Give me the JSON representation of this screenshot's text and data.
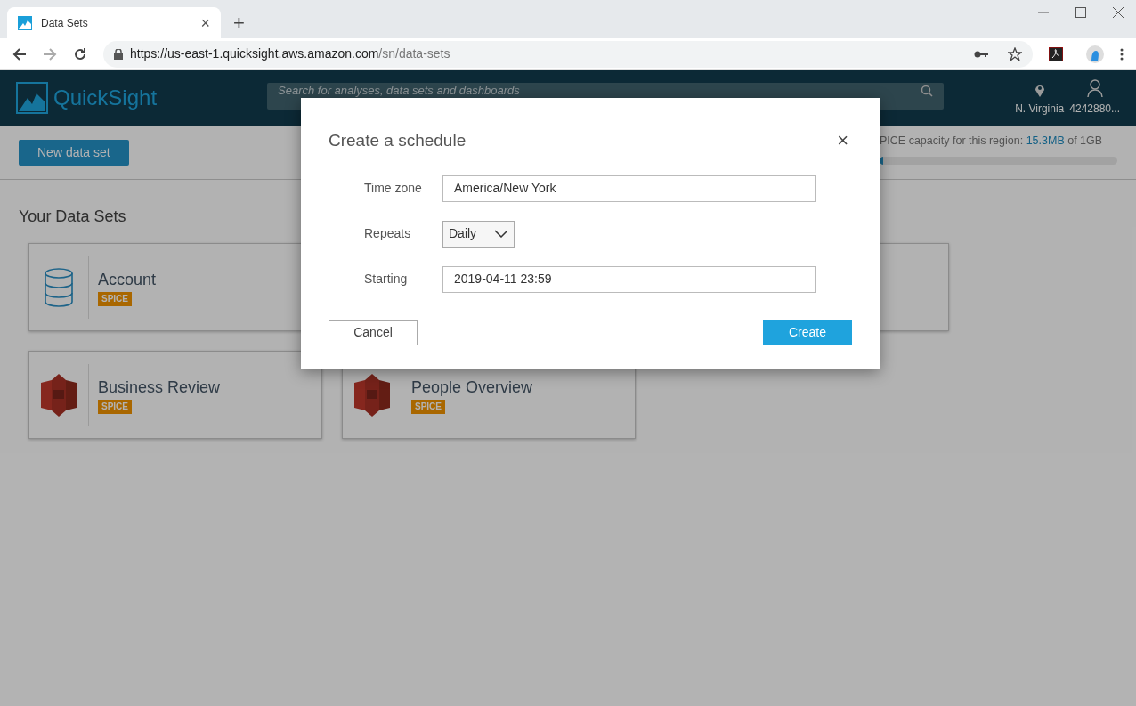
{
  "browser": {
    "tab_title": "Data Sets",
    "tab_close": "×",
    "new_tab": "+",
    "url_host": "https://us-east-1.quicksight.aws.amazon.com",
    "url_path": "/sn/data-sets"
  },
  "header": {
    "logo": "QuickSight",
    "search_placeholder": "Search for analyses, data sets and dashboards",
    "region": "N. Virginia",
    "account": "4242880..."
  },
  "toolbar": {
    "new_button": "New data set",
    "capacity_label": "PICE capacity for this region: ",
    "capacity_used": "15.3MB",
    "capacity_total": " of 1GB",
    "level": 0.0153
  },
  "section_title": "Your Data Sets",
  "cards": [
    {
      "kind": "database",
      "name": "Account",
      "badge": "SPICE"
    },
    {
      "kind": "hidden"
    },
    {
      "kind": "hidden"
    },
    {
      "kind": "s3",
      "name": "Business Review",
      "badge": "SPICE"
    },
    {
      "kind": "s3",
      "name": "People Overview",
      "badge": "SPICE"
    }
  ],
  "dialog": {
    "title": "Create a schedule",
    "close": "×",
    "fields": [
      {
        "kind": "text",
        "label": "Time zone",
        "value": "America/New York"
      },
      {
        "kind": "select",
        "label": "Repeats",
        "value": "Daily"
      },
      {
        "kind": "text",
        "label": "Starting",
        "value": "2019-04-11 23:59"
      }
    ],
    "cancel": "Cancel",
    "create": "Create"
  }
}
